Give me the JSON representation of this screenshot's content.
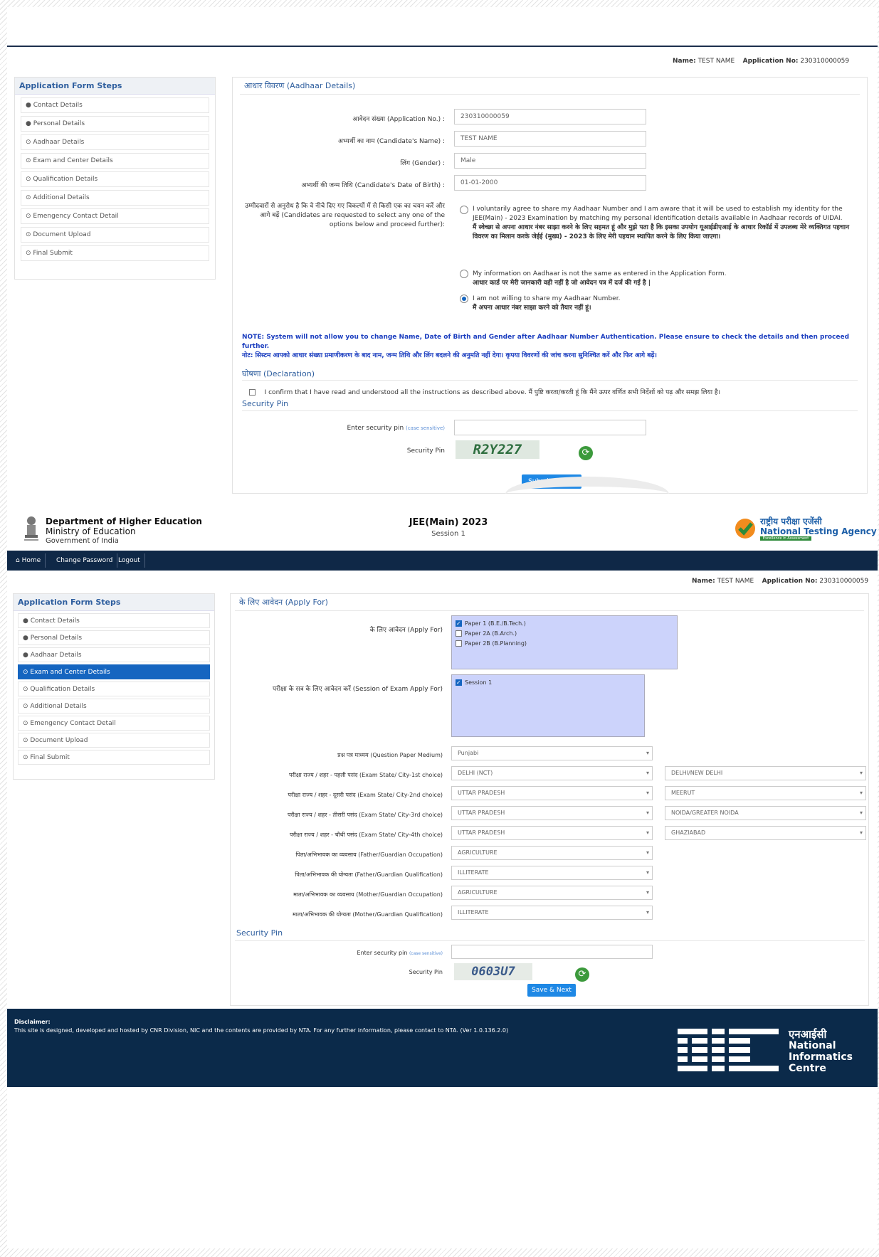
{
  "top": {
    "user": {
      "name_label": "Name:",
      "name": "TEST NAME",
      "app_label": "Application No:",
      "app_no": "230310000059"
    },
    "sidebar": {
      "title": "Application Form Steps",
      "items": [
        "Contact Details",
        "Personal Details",
        "Aadhaar Details",
        "Exam and Center Details",
        "Qualification Details",
        "Additional Details",
        "Emengency Contact Detail",
        "Document Upload",
        "Final Submit"
      ]
    },
    "panel_title": "आधार विवरण (Aadhaar Details)",
    "fields": [
      {
        "label": "आवेदन संख्या (Application No.) :",
        "value": "230310000059"
      },
      {
        "label": "अभ्यर्थी का नाम (Candidate's Name) :",
        "value": "TEST NAME"
      },
      {
        "label": "लिंग (Gender) :",
        "value": "Male"
      },
      {
        "label": "अभ्यर्थी की जन्म तिथि (Candidate's Date of Birth) :",
        "value": "01-01-2000"
      }
    ],
    "options_label": "उम्मीदवारों से अनुरोध है कि वे नीचे दिए गए विकल्पों में से किसी एक का चयन करें और आगे बढ़ें (Candidates are requested to select any one of the options below and proceed further):",
    "option1_en": "I voluntarily agree to share my Aadhaar Number and I am aware that it will be used to establish my identity for the JEE(Main) - 2023 Examination by matching my personal identification details available in Aadhaar records of UIDAI.",
    "option1_hi": "मैं स्वेच्छा से अपना आधार नंबर साझा करने के लिए सहमत हूं और मुझे पता है कि इसका उपयोग यूआईडीएआई के आधार रिकॉर्ड में उपलब्ध मेरे व्यक्तिगत पहचान विवरण का मिलान करके जेईई (मुख्य) - 2023 के लिए मेरी पहचान स्थापित करने के लिए किया जाएगा।",
    "option2_en": "My information on Aadhaar is not the same as entered in the Application Form.",
    "option2_hi": "आधार कार्ड पर मेरी जानकारी वही नहीं है जो आवेदन पत्र में दर्ज की गई है |",
    "option3_en": "I am not willing to share my Aadhaar Number.",
    "option3_hi": "मैं अपना आधार नंबर साझा करने को तैयार नहीं हूं।",
    "note_en": "NOTE: System will not allow you to change Name, Date of Birth and Gender after Aadhaar Number Authentication. Please ensure to check the details and then proceed further.",
    "note_hi": "नोट: सिस्टम आपको आधार संख्या प्रमाणीकरण के बाद नाम, जन्म तिथि और लिंग बदलने की अनुमति नहीं देगा। कृपया विवरणों की जांच करना सुनिश्चित करें और फिर आगे बढ़ें।",
    "declaration_title": "घोषणा (Declaration)",
    "declaration_text": "I confirm that I have read and understood all the instructions as described above. मैं पुष्टि करता/करती हूं कि मैंने ऊपर वर्णित सभी निर्देशों को पढ़ और समझ लिया है।",
    "security_title": "Security Pin",
    "enter_pin_label": "Enter security pin",
    "case_note": "(case sensitive)",
    "pin_label": "Security Pin",
    "captcha": "R2Y227",
    "submit": "Submit & Next"
  },
  "header": {
    "dept": "Department of Higher Education",
    "ministry": "Ministry of Education",
    "gov": "Government of India",
    "exam": "JEE(Main) 2023",
    "session": "Session 1",
    "nta_hi": "राष्ट्रीय परीक्षा एजेंसी",
    "nta_en": "National Testing Agency",
    "nta_tag": "Excellence in Assessment"
  },
  "nav": [
    "Home",
    "Change Password",
    "Logout"
  ],
  "bottom": {
    "user": {
      "name_label": "Name:",
      "name": "TEST NAME",
      "app_label": "Application No:",
      "app_no": "230310000059"
    },
    "sidebar": {
      "title": "Application Form Steps",
      "items": [
        "Contact Details",
        "Personal Details",
        "Aadhaar Details",
        "Exam and Center Details",
        "Qualification Details",
        "Additional Details",
        "Emengency Contact Detail",
        "Document Upload",
        "Final Submit"
      ]
    },
    "panel_title": "के लिए आवेदन (Apply For)",
    "apply_label": "के लिए आवेदन (Apply For)",
    "papers": [
      {
        "label": "Paper 1 (B.E./B.Tech.)",
        "checked": true
      },
      {
        "label": "Paper 2A (B.Arch.)",
        "checked": false
      },
      {
        "label": "Paper 2B (B.Planning)",
        "checked": false
      }
    ],
    "session_label": "परीक्षा के सत्र के लिए आवेदन करें (Session of Exam Apply For)",
    "sessions": [
      {
        "label": "Session 1",
        "checked": true
      }
    ],
    "medium_label": "प्रश्न पत्र माध्यम (Question Paper Medium)",
    "medium": "Punjabi",
    "city_rows": [
      {
        "label": "परीक्षा राज्य / शहर - पहली पसंद (Exam State/ City-1st choice)",
        "state": "DELHI (NCT)",
        "city": "DELHI/NEW DELHI"
      },
      {
        "label": "परीक्षा राज्य / शहर - दूसरी पसंद (Exam State/ City-2nd choice)",
        "state": "UTTAR PRADESH",
        "city": "MEERUT"
      },
      {
        "label": "परीक्षा राज्य / शहर - तीसरी पसंद (Exam State/ City-3rd choice)",
        "state": "UTTAR PRADESH",
        "city": "NOIDA/GREATER NOIDA"
      },
      {
        "label": "परीक्षा राज्य / शहर - चौथी पसंद (Exam State/ City-4th choice)",
        "state": "UTTAR PRADESH",
        "city": "GHAZIABAD"
      }
    ],
    "parent_rows": [
      {
        "label": "पिता/अभिभावक का व्यवसाय (Father/Guardian Occupation)",
        "value": "AGRICULTURE"
      },
      {
        "label": "पिता/अभिभावक की योग्यता (Father/Guardian Qualification)",
        "value": "ILLITERATE"
      },
      {
        "label": "माता/अभिभावक का व्यवसाय (Mother/Guardian Occupation)",
        "value": "AGRICULTURE"
      },
      {
        "label": "माता/अभिभावक की योग्यता (Mother/Guardian Qualification)",
        "value": "ILLITERATE"
      }
    ],
    "security_title": "Security Pin",
    "enter_pin_label": "Enter security pin",
    "case_note": "(case sensitive)",
    "pin_label": "Security Pin",
    "captcha": "0603U7",
    "save": "Save & Next"
  },
  "footer": {
    "disclaimer_title": "Disclaimer:",
    "disclaimer": "This site is designed, developed and hosted by CNR Division, NIC and the contents are provided by NTA. For any further information, please contact to NTA. (Ver 1.0.136.2.0)",
    "nic_hi": "एनआईसी",
    "nic_en1": "National",
    "nic_en2": "Informatics",
    "nic_en3": "Centre",
    "nic_logo": "NIC"
  },
  "colors": {
    "navy": "#0b2a4a",
    "accent": "#1565c0",
    "nav_bg": "#0f2847"
  }
}
